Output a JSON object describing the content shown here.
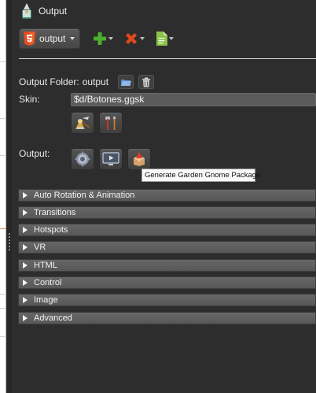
{
  "window": {
    "title": "Output"
  },
  "toolbar": {
    "output_dropdown_label": "output",
    "add_tooltip": "",
    "remove_tooltip": ""
  },
  "output_folder": {
    "label": "Output Folder:",
    "value": "output"
  },
  "skin": {
    "label": "Skin:",
    "value": "$d/Botones.ggsk"
  },
  "output": {
    "label": "Output:"
  },
  "tooltip": {
    "text": "Generate Garden Gnome Package"
  },
  "sections": [
    {
      "label": "Auto Rotation & Animation"
    },
    {
      "label": "Transitions"
    },
    {
      "label": "Hotspots"
    },
    {
      "label": "VR"
    },
    {
      "label": "HTML"
    },
    {
      "label": "Control"
    },
    {
      "label": "Image"
    },
    {
      "label": "Advanced"
    }
  ],
  "colors": {
    "add": "#4caf2f",
    "remove": "#e04a1a",
    "section_bg": "#5f5f5f"
  }
}
